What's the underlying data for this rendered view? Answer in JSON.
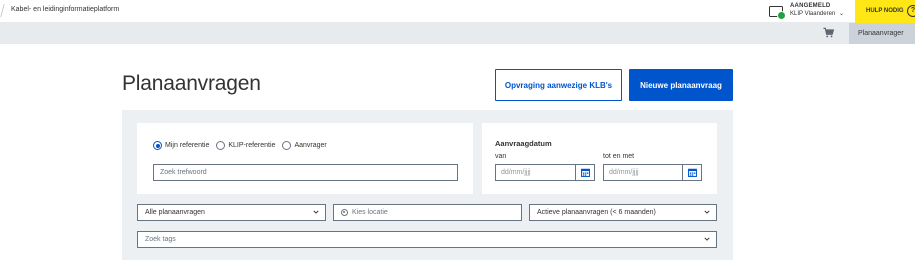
{
  "header": {
    "site_title": "Kabel- en leidinginformatieplatform",
    "account_status": "AANGEMELD",
    "account_org": "KLIP Vlaanderen",
    "help_label": "HULP NODIG",
    "help_icon": "?"
  },
  "subnav": {
    "active_tab": "Planaanvrager",
    "cart_icon": "cart-icon"
  },
  "page": {
    "title": "Planaanvragen",
    "btn_existing": "Opvraging aanwezige KLB's",
    "btn_new": "Nieuwe planaanvraag"
  },
  "search": {
    "radio_options": [
      "Mijn referentie",
      "KLIP-referentie",
      "Aanvrager"
    ],
    "selected_radio": "Mijn referentie",
    "keyword_placeholder": "Zoek trefwoord"
  },
  "date": {
    "heading": "Aanvraagdatum",
    "from_label": "van",
    "to_label": "tot en met",
    "from_placeholder": "dd/mm/jjjj",
    "to_placeholder": "dd/mm/jjjj"
  },
  "filters": {
    "all_requests": "Alle planaanvragen",
    "location_placeholder": "Kies locatie",
    "active_requests": "Actieve planaanvragen (< 6 maanden)",
    "tags_placeholder": "Zoek tags"
  },
  "colors": {
    "primary": "#0055cc",
    "help_yellow": "#ffe615",
    "status_green": "#22a043"
  }
}
